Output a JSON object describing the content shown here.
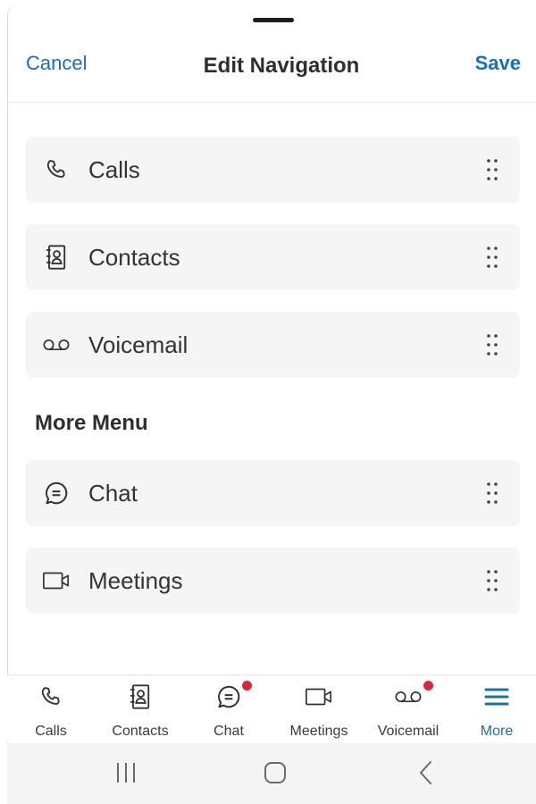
{
  "header": {
    "cancel_label": "Cancel",
    "title": "Edit Navigation",
    "save_label": "Save"
  },
  "nav_items": [
    {
      "label": "Calls",
      "icon": "phone-icon"
    },
    {
      "label": "Contacts",
      "icon": "contacts-book-icon"
    },
    {
      "label": "Voicemail",
      "icon": "voicemail-icon"
    }
  ],
  "more_menu": {
    "title": "More Menu",
    "items": [
      {
        "label": "Chat",
        "icon": "chat-bubble-icon"
      },
      {
        "label": "Meetings",
        "icon": "video-camera-icon"
      }
    ]
  },
  "tabbar": {
    "tabs": [
      {
        "label": "Calls",
        "icon": "phone-icon",
        "badge": false,
        "active": false
      },
      {
        "label": "Contacts",
        "icon": "contacts-book-icon",
        "badge": false,
        "active": false
      },
      {
        "label": "Chat",
        "icon": "chat-bubble-icon",
        "badge": true,
        "active": false
      },
      {
        "label": "Meetings",
        "icon": "video-camera-icon",
        "badge": false,
        "active": false
      },
      {
        "label": "Voicemail",
        "icon": "voicemail-icon",
        "badge": true,
        "active": false
      },
      {
        "label": "More",
        "icon": "hamburger-menu-icon",
        "badge": false,
        "active": true
      }
    ]
  },
  "colors": {
    "accent": "#1a6fb0",
    "badge": "#d7283a",
    "card_bg": "#f5f5f5",
    "text": "#333333"
  }
}
